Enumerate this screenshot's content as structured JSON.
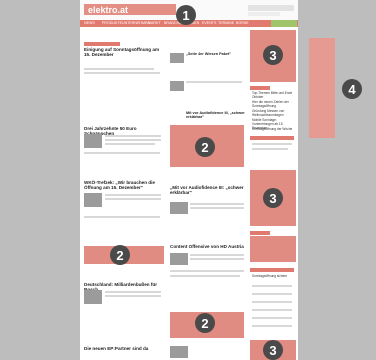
{
  "header": {
    "logo": "elektro.at",
    "tagline": "DER ONLINE-DIENST DER E&W"
  },
  "nav": [
    "NEWS",
    "PRODUKTE",
    "UNTERNEHMEN",
    "MARKT",
    "BRANCHE",
    "MESSEN",
    "EVENTS",
    "TERMINE",
    "BÖRSE"
  ],
  "articles": {
    "a1": {
      "title": "Einigung auf Sonntagsöffnung am 15. Dezember"
    },
    "a2": {
      "title": "Drei Jahrzehnte 50 Euro Schnäppchen"
    },
    "a3": {
      "title": "WKÖ-Trefzek: „Wir brauchen die Öffnung am 15. Dezember\""
    },
    "a4": {
      "title": "Deutschland: Milliardenbußen für Bosch"
    },
    "a5": {
      "title": "Die neuen EP:Partner sind da"
    },
    "m1": {
      "title": "„Mit vor Audiofidence III: „schwer erklärbar\""
    },
    "m2": {
      "title": "Content Offensive von HD Austria"
    },
    "m3": {
      "title": "Mit vor Audiofidence III, „schwer erklärbar\""
    },
    "m4": {
      "title": "„Seite 4er Wiesen Paket\""
    }
  },
  "sidebar": {
    "items": [
      "Top-Themen Mitte und Ende Oktober",
      "Hier die neuen Zahlen der Sonntagsöffnung",
      "Gründung Messen von Weihnachtssonntagen",
      "Mobile Sonntage: Vorbereitungen ab 15. Dezember"
    ],
    "links": [
      "Sonntagsöffnung der Woche",
      "Sonntagsöffnung sichern"
    ]
  },
  "markers": [
    "1",
    "2",
    "2",
    "2",
    "3",
    "3",
    "3",
    "4"
  ]
}
